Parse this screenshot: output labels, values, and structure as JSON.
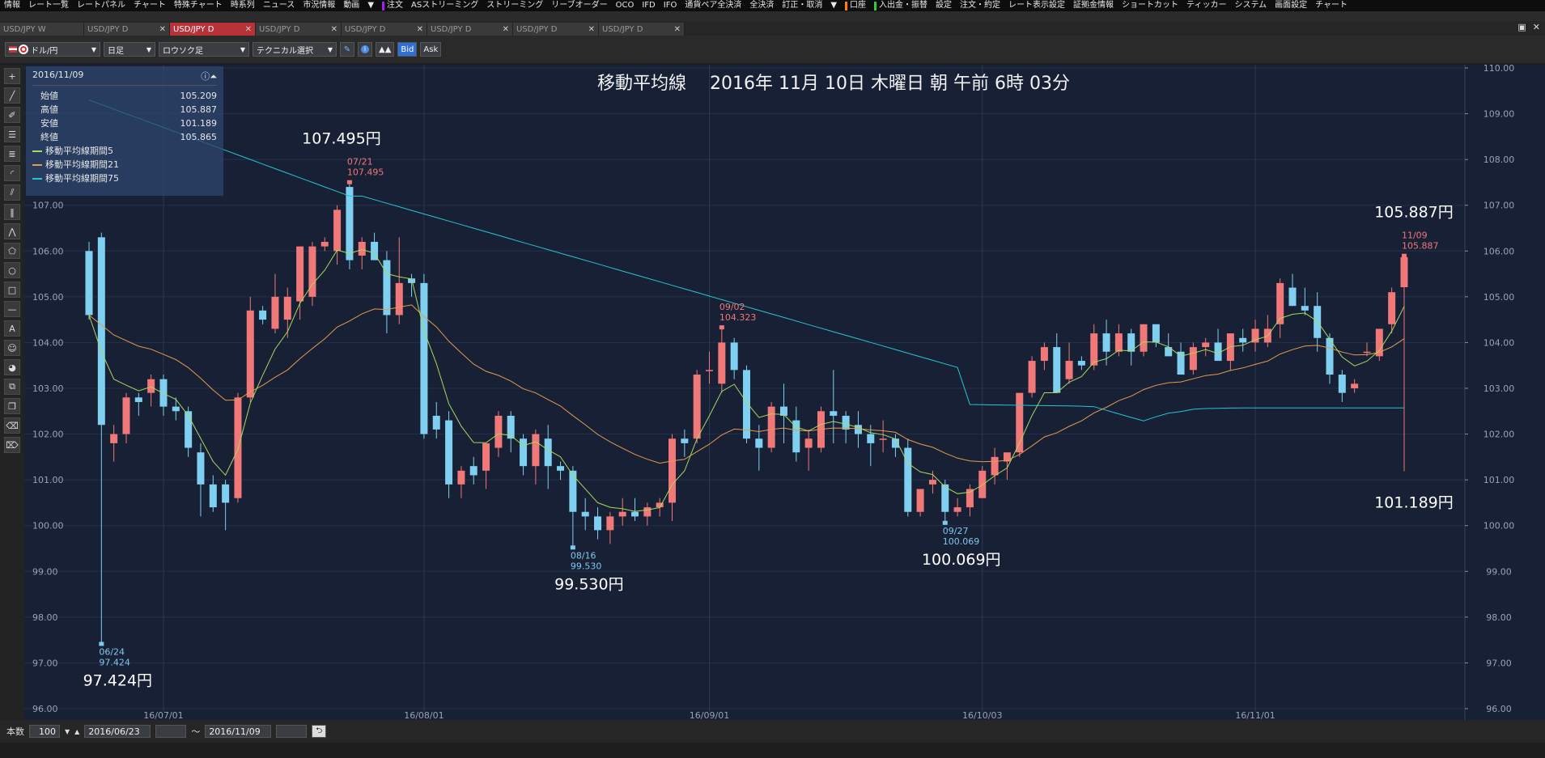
{
  "menu": {
    "items": [
      "情報",
      "レート一覧",
      "レートパネル",
      "チャート",
      "特殊チャート",
      "時系列",
      "ニュース",
      "市況情報",
      "動画",
      "▼",
      "注文",
      "ASストリーミング",
      "ストリーミング",
      "リーブオーダー",
      "OCO",
      "IFD",
      "IFO",
      "通貨ペア全決済",
      "全決済",
      "訂正・取消",
      "▼",
      "口座",
      "入出金・振替",
      "設定",
      "注文・約定",
      "レート表示設定",
      "証拠金情報",
      "ショートカット",
      "ティッカー",
      "システム",
      "画面設定",
      "チャート"
    ],
    "accent_order": "#a020f0",
    "accent_account": "#ff7f00",
    "accent_deposit": "#33cc33"
  },
  "tabs": [
    {
      "label": "USD/JPY W",
      "active": false
    },
    {
      "label": "USD/JPY D",
      "active": false
    },
    {
      "label": "USD/JPY D",
      "active": true
    },
    {
      "label": "USD/JPY D",
      "active": false
    },
    {
      "label": "USD/JPY D",
      "active": false
    },
    {
      "label": "USD/JPY D",
      "active": false
    },
    {
      "label": "USD/JPY D",
      "active": false
    },
    {
      "label": "USD/JPY D",
      "active": false
    }
  ],
  "toolbar": {
    "pair": "ドル/円",
    "period": "日足",
    "type": "ロウソク足",
    "technical": "テクニカル選択",
    "bid": "Bid",
    "ask": "Ask"
  },
  "info_panel": {
    "date": "2016/11/09",
    "rows": [
      {
        "label": "始値",
        "value": "105.209"
      },
      {
        "label": "高値",
        "value": "105.887"
      },
      {
        "label": "安値",
        "value": "101.189"
      },
      {
        "label": "終値",
        "value": "105.865"
      }
    ],
    "ma": [
      {
        "label": "移動平均線期間5",
        "color": "#a8d95c"
      },
      {
        "label": "移動平均線期間21",
        "color": "#e59a4f"
      },
      {
        "label": "移動平均線期間75",
        "color": "#26c6d0"
      }
    ]
  },
  "chart_data": {
    "type": "candlestick",
    "title": "移動平均線　 2016年 11月 10日 木曜日 朝 午前 6時 03分",
    "ylim": [
      96,
      110
    ],
    "yticks": [
      "96.00",
      "97.00",
      "98.00",
      "99.00",
      "100.00",
      "101.00",
      "102.00",
      "103.00",
      "104.00",
      "105.00",
      "106.00",
      "107.00",
      "108.00",
      "109.00",
      "110.00"
    ],
    "xticks": [
      {
        "label": "16/07/01",
        "i": 6
      },
      {
        "label": "16/08/01",
        "i": 27
      },
      {
        "label": "16/09/01",
        "i": 50
      },
      {
        "label": "16/10/03",
        "i": 72
      },
      {
        "label": "16/11/01",
        "i": 94
      }
    ],
    "candles": [
      [
        106.0,
        106.2,
        104.5,
        104.6
      ],
      [
        106.3,
        106.4,
        97.424,
        102.2
      ],
      [
        101.8,
        102.2,
        101.4,
        102.0
      ],
      [
        102.0,
        102.9,
        101.8,
        102.8
      ],
      [
        102.8,
        102.9,
        102.4,
        102.7
      ],
      [
        102.9,
        103.3,
        102.6,
        103.2
      ],
      [
        103.2,
        103.3,
        102.4,
        102.6
      ],
      [
        102.6,
        102.8,
        102.3,
        102.5
      ],
      [
        102.5,
        102.6,
        101.5,
        101.7
      ],
      [
        101.6,
        101.8,
        100.2,
        100.9
      ],
      [
        100.9,
        101.1,
        100.3,
        100.4
      ],
      [
        100.9,
        101.0,
        99.9,
        100.5
      ],
      [
        100.6,
        102.9,
        100.5,
        102.8
      ],
      [
        102.8,
        105.0,
        102.7,
        104.7
      ],
      [
        104.7,
        104.8,
        104.4,
        104.5
      ],
      [
        104.3,
        105.5,
        104.2,
        105.0
      ],
      [
        104.5,
        105.2,
        104.1,
        105.0
      ],
      [
        104.9,
        105.8,
        104.5,
        106.1
      ],
      [
        105.0,
        106.2,
        104.8,
        106.1
      ],
      [
        106.1,
        106.3,
        106.0,
        106.2
      ],
      [
        106.0,
        107.0,
        105.7,
        106.9
      ],
      [
        107.4,
        107.495,
        105.6,
        105.8
      ],
      [
        105.9,
        106.3,
        105.6,
        106.2
      ],
      [
        106.2,
        106.4,
        105.9,
        105.8
      ],
      [
        105.8,
        106.0,
        104.2,
        104.6
      ],
      [
        104.6,
        106.3,
        104.4,
        105.3
      ],
      [
        105.4,
        105.5,
        105.0,
        105.3
      ],
      [
        105.3,
        105.5,
        101.9,
        102.0
      ],
      [
        102.4,
        102.7,
        101.9,
        102.1
      ],
      [
        102.3,
        102.5,
        100.6,
        100.9
      ],
      [
        100.9,
        101.3,
        100.6,
        101.2
      ],
      [
        101.3,
        101.5,
        100.9,
        101.1
      ],
      [
        101.2,
        101.8,
        100.8,
        101.8
      ],
      [
        101.7,
        102.5,
        101.5,
        102.4
      ],
      [
        102.4,
        102.5,
        101.6,
        101.9
      ],
      [
        101.9,
        102.0,
        101.1,
        101.3
      ],
      [
        101.3,
        102.1,
        100.9,
        102.0
      ],
      [
        101.9,
        102.2,
        100.8,
        101.3
      ],
      [
        101.3,
        101.4,
        101.0,
        101.2
      ],
      [
        101.2,
        101.3,
        99.53,
        100.3
      ],
      [
        100.3,
        100.6,
        99.9,
        100.2
      ],
      [
        100.2,
        100.4,
        99.7,
        99.9
      ],
      [
        99.9,
        100.3,
        99.6,
        100.2
      ],
      [
        100.2,
        100.6,
        100.0,
        100.3
      ],
      [
        100.3,
        100.6,
        100.1,
        100.2
      ],
      [
        100.2,
        100.5,
        100.0,
        100.4
      ],
      [
        100.4,
        100.6,
        100.2,
        100.5
      ],
      [
        100.5,
        102.0,
        100.1,
        101.9
      ],
      [
        101.9,
        102.1,
        101.5,
        101.8
      ],
      [
        101.9,
        103.4,
        101.8,
        103.3
      ],
      [
        103.4,
        103.8,
        103.1,
        103.4
      ],
      [
        103.1,
        104.323,
        102.9,
        104.0
      ],
      [
        104.0,
        104.1,
        103.2,
        103.4
      ],
      [
        103.4,
        103.5,
        101.8,
        101.9
      ],
      [
        101.9,
        102.2,
        101.2,
        101.7
      ],
      [
        101.7,
        102.7,
        101.6,
        102.6
      ],
      [
        102.6,
        103.1,
        101.8,
        102.4
      ],
      [
        102.3,
        102.6,
        101.4,
        101.6
      ],
      [
        101.7,
        102.1,
        101.2,
        101.9
      ],
      [
        101.7,
        102.6,
        101.6,
        102.5
      ],
      [
        102.5,
        103.4,
        101.8,
        102.4
      ],
      [
        102.4,
        102.5,
        101.8,
        102.1
      ],
      [
        102.2,
        102.5,
        101.7,
        102.0
      ],
      [
        102.0,
        102.2,
        101.3,
        101.8
      ],
      [
        101.9,
        102.3,
        101.6,
        101.9
      ],
      [
        101.9,
        102.0,
        101.5,
        101.7
      ],
      [
        101.7,
        101.9,
        100.2,
        100.3
      ],
      [
        100.3,
        100.8,
        100.2,
        100.8
      ],
      [
        100.9,
        101.2,
        100.7,
        101.0
      ],
      [
        100.9,
        101.0,
        100.069,
        100.3
      ],
      [
        100.3,
        100.6,
        100.2,
        100.4
      ],
      [
        100.4,
        100.9,
        100.2,
        100.8
      ],
      [
        100.6,
        101.3,
        100.6,
        101.2
      ],
      [
        101.1,
        101.7,
        100.9,
        101.5
      ],
      [
        101.4,
        101.6,
        101.0,
        101.6
      ],
      [
        101.6,
        102.9,
        101.5,
        102.9
      ],
      [
        102.9,
        103.7,
        102.8,
        103.6
      ],
      [
        103.6,
        104.0,
        103.4,
        103.9
      ],
      [
        103.9,
        104.2,
        102.9,
        102.9
      ],
      [
        103.2,
        104.0,
        103.1,
        103.6
      ],
      [
        103.6,
        103.7,
        103.4,
        103.5
      ],
      [
        103.5,
        104.4,
        103.4,
        104.2
      ],
      [
        104.2,
        104.5,
        103.5,
        103.8
      ],
      [
        103.8,
        104.4,
        103.7,
        104.2
      ],
      [
        104.2,
        104.3,
        103.5,
        103.8
      ],
      [
        103.8,
        104.4,
        103.7,
        104.4
      ],
      [
        104.4,
        104.4,
        103.9,
        104.0
      ],
      [
        103.9,
        104.2,
        103.7,
        103.7
      ],
      [
        103.8,
        104.0,
        103.3,
        103.3
      ],
      [
        103.4,
        104.0,
        103.3,
        103.9
      ],
      [
        103.9,
        104.1,
        103.7,
        104.0
      ],
      [
        104.0,
        104.3,
        103.6,
        103.6
      ],
      [
        103.6,
        104.2,
        103.4,
        104.2
      ],
      [
        104.1,
        104.3,
        103.8,
        104.0
      ],
      [
        104.0,
        104.5,
        103.8,
        104.3
      ],
      [
        104.0,
        104.6,
        103.9,
        104.3
      ],
      [
        104.4,
        105.4,
        104.1,
        105.3
      ],
      [
        105.2,
        105.5,
        104.8,
        104.8
      ],
      [
        104.8,
        105.2,
        104.6,
        104.7
      ],
      [
        104.8,
        105.1,
        103.8,
        104.1
      ],
      [
        104.1,
        104.2,
        103.1,
        103.3
      ],
      [
        103.3,
        103.4,
        102.7,
        102.9
      ],
      [
        103.0,
        103.2,
        102.9,
        103.1
      ],
      [
        103.8,
        104.0,
        103.7,
        103.8
      ],
      [
        103.7,
        104.3,
        103.6,
        104.3
      ],
      [
        104.4,
        105.2,
        104.2,
        105.1
      ],
      [
        105.209,
        105.887,
        101.189,
        105.865
      ]
    ],
    "ma_label_colors": {
      "ma5": "#a8d95c",
      "ma21": "#e59a4f",
      "ma75": "#26c6d0"
    },
    "ma75_start": [
      109.3,
      109.2,
      109.1,
      109.0,
      108.9,
      108.8,
      108.7,
      108.6,
      108.5,
      108.4,
      108.3,
      108.2,
      108.1,
      108.0,
      107.9,
      107.8,
      107.7,
      107.6,
      107.5,
      107.4,
      107.3,
      107.2
    ],
    "annotations": [
      {
        "i": 1,
        "price": 97.424,
        "date": "06/24",
        "value": "97.424",
        "big": "97.424円",
        "side": "low",
        "color": "#7fc8ef"
      },
      {
        "i": 21,
        "price": 107.495,
        "date": "07/21",
        "value": "107.495",
        "big": "107.495円",
        "side": "high",
        "color": "#f07878"
      },
      {
        "i": 39,
        "price": 99.53,
        "date": "08/16",
        "value": "99.530",
        "big": "99.530円",
        "side": "low",
        "color": "#7fc8ef"
      },
      {
        "i": 51,
        "price": 104.323,
        "date": "09/02",
        "value": "104.323",
        "big": "",
        "side": "high",
        "color": "#f07878"
      },
      {
        "i": 69,
        "price": 100.069,
        "date": "09/27",
        "value": "100.069",
        "big": "100.069円",
        "side": "low",
        "color": "#7fc8ef"
      },
      {
        "i": 106,
        "price": 105.887,
        "date": "11/09",
        "value": "105.887",
        "big": "105.887円",
        "side": "high",
        "color": "#f07878"
      },
      {
        "i": 106,
        "price": 101.189,
        "date": "",
        "value": "",
        "big": "101.189円",
        "side": "low2",
        "color": "#7fc8ef"
      }
    ],
    "up_color": "#f07878",
    "down_color": "#7fd0f0",
    "grid": true
  },
  "bottom": {
    "count_label": "本数",
    "count": "100",
    "from": "2016/06/23",
    "tilde": "～",
    "to": "2016/11/09"
  }
}
